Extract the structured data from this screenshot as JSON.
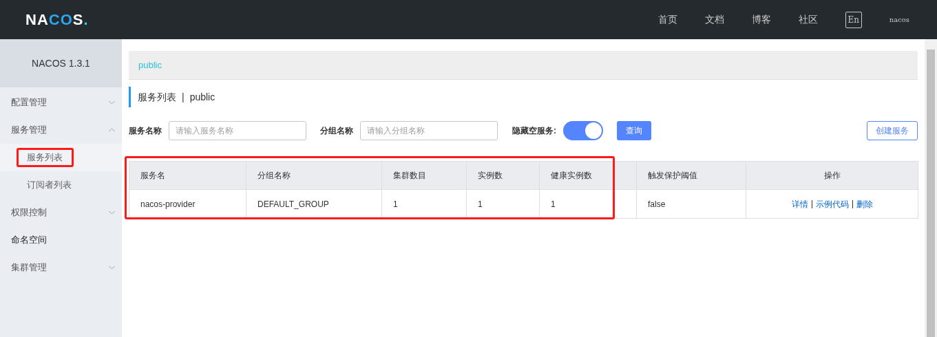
{
  "header": {
    "logo": "NACOS.",
    "nav": [
      {
        "label": "首页"
      },
      {
        "label": "文档"
      },
      {
        "label": "博客"
      },
      {
        "label": "社区"
      }
    ],
    "language_button": "En",
    "user": "nacos"
  },
  "sidebar": {
    "title": "NACOS 1.3.1",
    "items": [
      {
        "kind": "group",
        "label": "配置管理",
        "expanded": false
      },
      {
        "kind": "group",
        "label": "服务管理",
        "expanded": true,
        "children": [
          {
            "label": "服务列表",
            "selected": true,
            "highlighted": true
          },
          {
            "label": "订阅者列表",
            "selected": false,
            "highlighted": false
          }
        ]
      },
      {
        "kind": "group",
        "label": "权限控制",
        "expanded": false
      },
      {
        "kind": "link",
        "label": "命名空间"
      },
      {
        "kind": "group",
        "label": "集群管理",
        "expanded": false
      }
    ]
  },
  "breadcrumb": "public",
  "page_title": {
    "title": "服务列表",
    "separator": "|",
    "namespace": "public"
  },
  "filters": {
    "service_name": {
      "label": "服务名称",
      "placeholder": "请输入服务名称"
    },
    "group_name": {
      "label": "分组名称",
      "placeholder": "请输入分组名称"
    },
    "hide_empty": {
      "label": "隐藏空服务:",
      "on": true
    },
    "query_button": "查询",
    "create_button": "创建服务"
  },
  "table": {
    "highlighted": true,
    "columns": [
      "服务名",
      "分组名称",
      "集群数目",
      "实例数",
      "健康实例数",
      "触发保护阈值",
      "操作"
    ],
    "rows": [
      {
        "cells": [
          "nacos-provider",
          "DEFAULT_GROUP",
          "1",
          "1",
          "1",
          "false"
        ],
        "actions": [
          {
            "label": "详情"
          },
          {
            "label": "示例代码"
          },
          {
            "label": "删除"
          }
        ]
      }
    ]
  }
}
